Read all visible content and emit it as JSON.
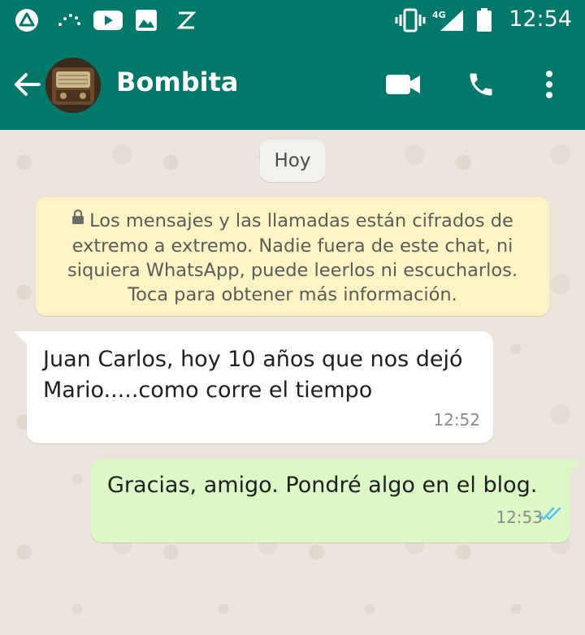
{
  "status_bar": {
    "time": "12:54",
    "network": "4G",
    "icons": [
      "app-notification-icon",
      "dots-icon",
      "youtube-icon",
      "gallery-icon",
      "z-icon",
      "vibrate-icon",
      "signal-icon",
      "battery-icon"
    ]
  },
  "header": {
    "contact_name": "Bombita",
    "actions": [
      "video-call-icon",
      "phone-call-icon",
      "more-options-icon"
    ]
  },
  "chat": {
    "date_label": "Hoy",
    "encryption_notice": "Los mensajes y las llamadas están cifrados de extremo a extremo. Nadie fuera de este chat, ni siquiera WhatsApp, puede leerlos ni escucharlos. Toca para obtener más información.",
    "messages": [
      {
        "direction": "incoming",
        "text": "Juan Carlos,  hoy 10 años que nos dejó Mario.....como corre el tiempo",
        "time": "12:52"
      },
      {
        "direction": "outgoing",
        "text": "Gracias, amigo. Pondré algo en el blog.",
        "time": "12:53",
        "status": "read"
      }
    ]
  },
  "colors": {
    "header": "#00796B",
    "chat_background": "#ECE5DD",
    "incoming_bubble": "#FFFFFF",
    "outgoing_bubble": "#DCF8C6",
    "notice_bubble": "#FDF4C5",
    "read_ticks": "#4FC3F7"
  }
}
